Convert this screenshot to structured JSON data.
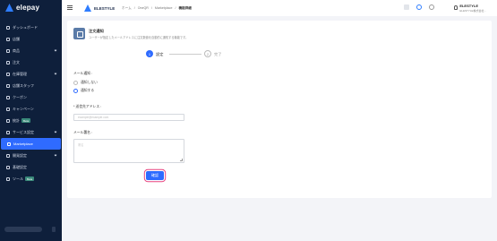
{
  "logo": {
    "text": "elepay"
  },
  "sidebar": {
    "items": [
      {
        "label": "ダッシュボード",
        "chevron": false,
        "active": false
      },
      {
        "label": "店舗",
        "chevron": false,
        "active": false
      },
      {
        "label": "商品",
        "chevron": true,
        "active": false
      },
      {
        "label": "注文",
        "chevron": false,
        "active": false
      },
      {
        "label": "在庫管理",
        "chevron": true,
        "active": false
      },
      {
        "label": "店舗スタッフ",
        "chevron": false,
        "active": false
      },
      {
        "label": "クーポン",
        "chevron": false,
        "active": false
      },
      {
        "label": "キャンペーン",
        "chevron": false,
        "active": false
      },
      {
        "label": "統計",
        "badge": "Beta",
        "chevron": false,
        "active": false
      },
      {
        "label": "サービス設定",
        "chevron": true,
        "active": false
      },
      {
        "label": "Marketplace",
        "chevron": false,
        "active": true
      },
      {
        "label": "開発設定",
        "chevron": true,
        "active": false
      },
      {
        "label": "基礎設定",
        "chevron": false,
        "active": false
      },
      {
        "label": "ツール",
        "badge": "Beta",
        "chevron": false,
        "active": false
      }
    ]
  },
  "header": {
    "brand": "ELESTYLE",
    "breadcrumb": [
      "ホーム",
      "OneQR",
      "Marketplace",
      "機能詳細"
    ],
    "user_name": "ELESTYLE",
    "user_sub": "ELESTYLE株式会社..."
  },
  "card": {
    "title": "注文通知",
    "description": "ユーザーが指定したメールアドレスに注文数値を自動的に通知する機能です。"
  },
  "steps": [
    {
      "num": "1",
      "label": "設定"
    },
    {
      "num": "2",
      "label": "完了"
    }
  ],
  "form": {
    "notify_label": "メール通知 :",
    "options": [
      "通知しない",
      "通知する"
    ],
    "selected": "通知する",
    "address_label": "* 送信先アドレス :",
    "address_placeholder": "example@example.com",
    "subject_label": "メール署名 :",
    "subject_placeholder": "署名",
    "confirm_label": "確認"
  },
  "colors": {
    "sidebar_bg": "#0e1f3b",
    "accent": "#2e6bff",
    "focus_ring": "#e8437f"
  }
}
